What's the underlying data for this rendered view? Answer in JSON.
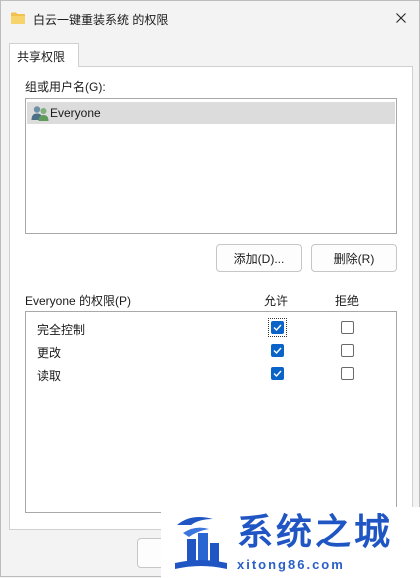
{
  "window": {
    "title": "白云一键重装系统 的权限",
    "icons": {
      "title": "folder-icon",
      "close": "close-icon"
    }
  },
  "tabs": [
    {
      "label": "共享权限",
      "selected": true
    }
  ],
  "groups": {
    "label": "组或用户名(G):",
    "items": [
      {
        "name": "Everyone",
        "icon": "users-icon",
        "selected": true
      }
    ]
  },
  "buttons": {
    "add": "添加(D)...",
    "remove": "删除(R)"
  },
  "permissions": {
    "label": "Everyone 的权限(P)",
    "allow_header": "允许",
    "deny_header": "拒绝",
    "rows": [
      {
        "name": "完全控制",
        "allow": true,
        "deny": false
      },
      {
        "name": "更改",
        "allow": true,
        "deny": false
      },
      {
        "name": "读取",
        "allow": true,
        "deny": false
      }
    ]
  },
  "watermark": {
    "title": "系统之城",
    "url": "xitong86.com"
  },
  "colors": {
    "accent": "#0a64c8",
    "watermark": "#1f56c4",
    "selection": "#dcdcdc"
  }
}
